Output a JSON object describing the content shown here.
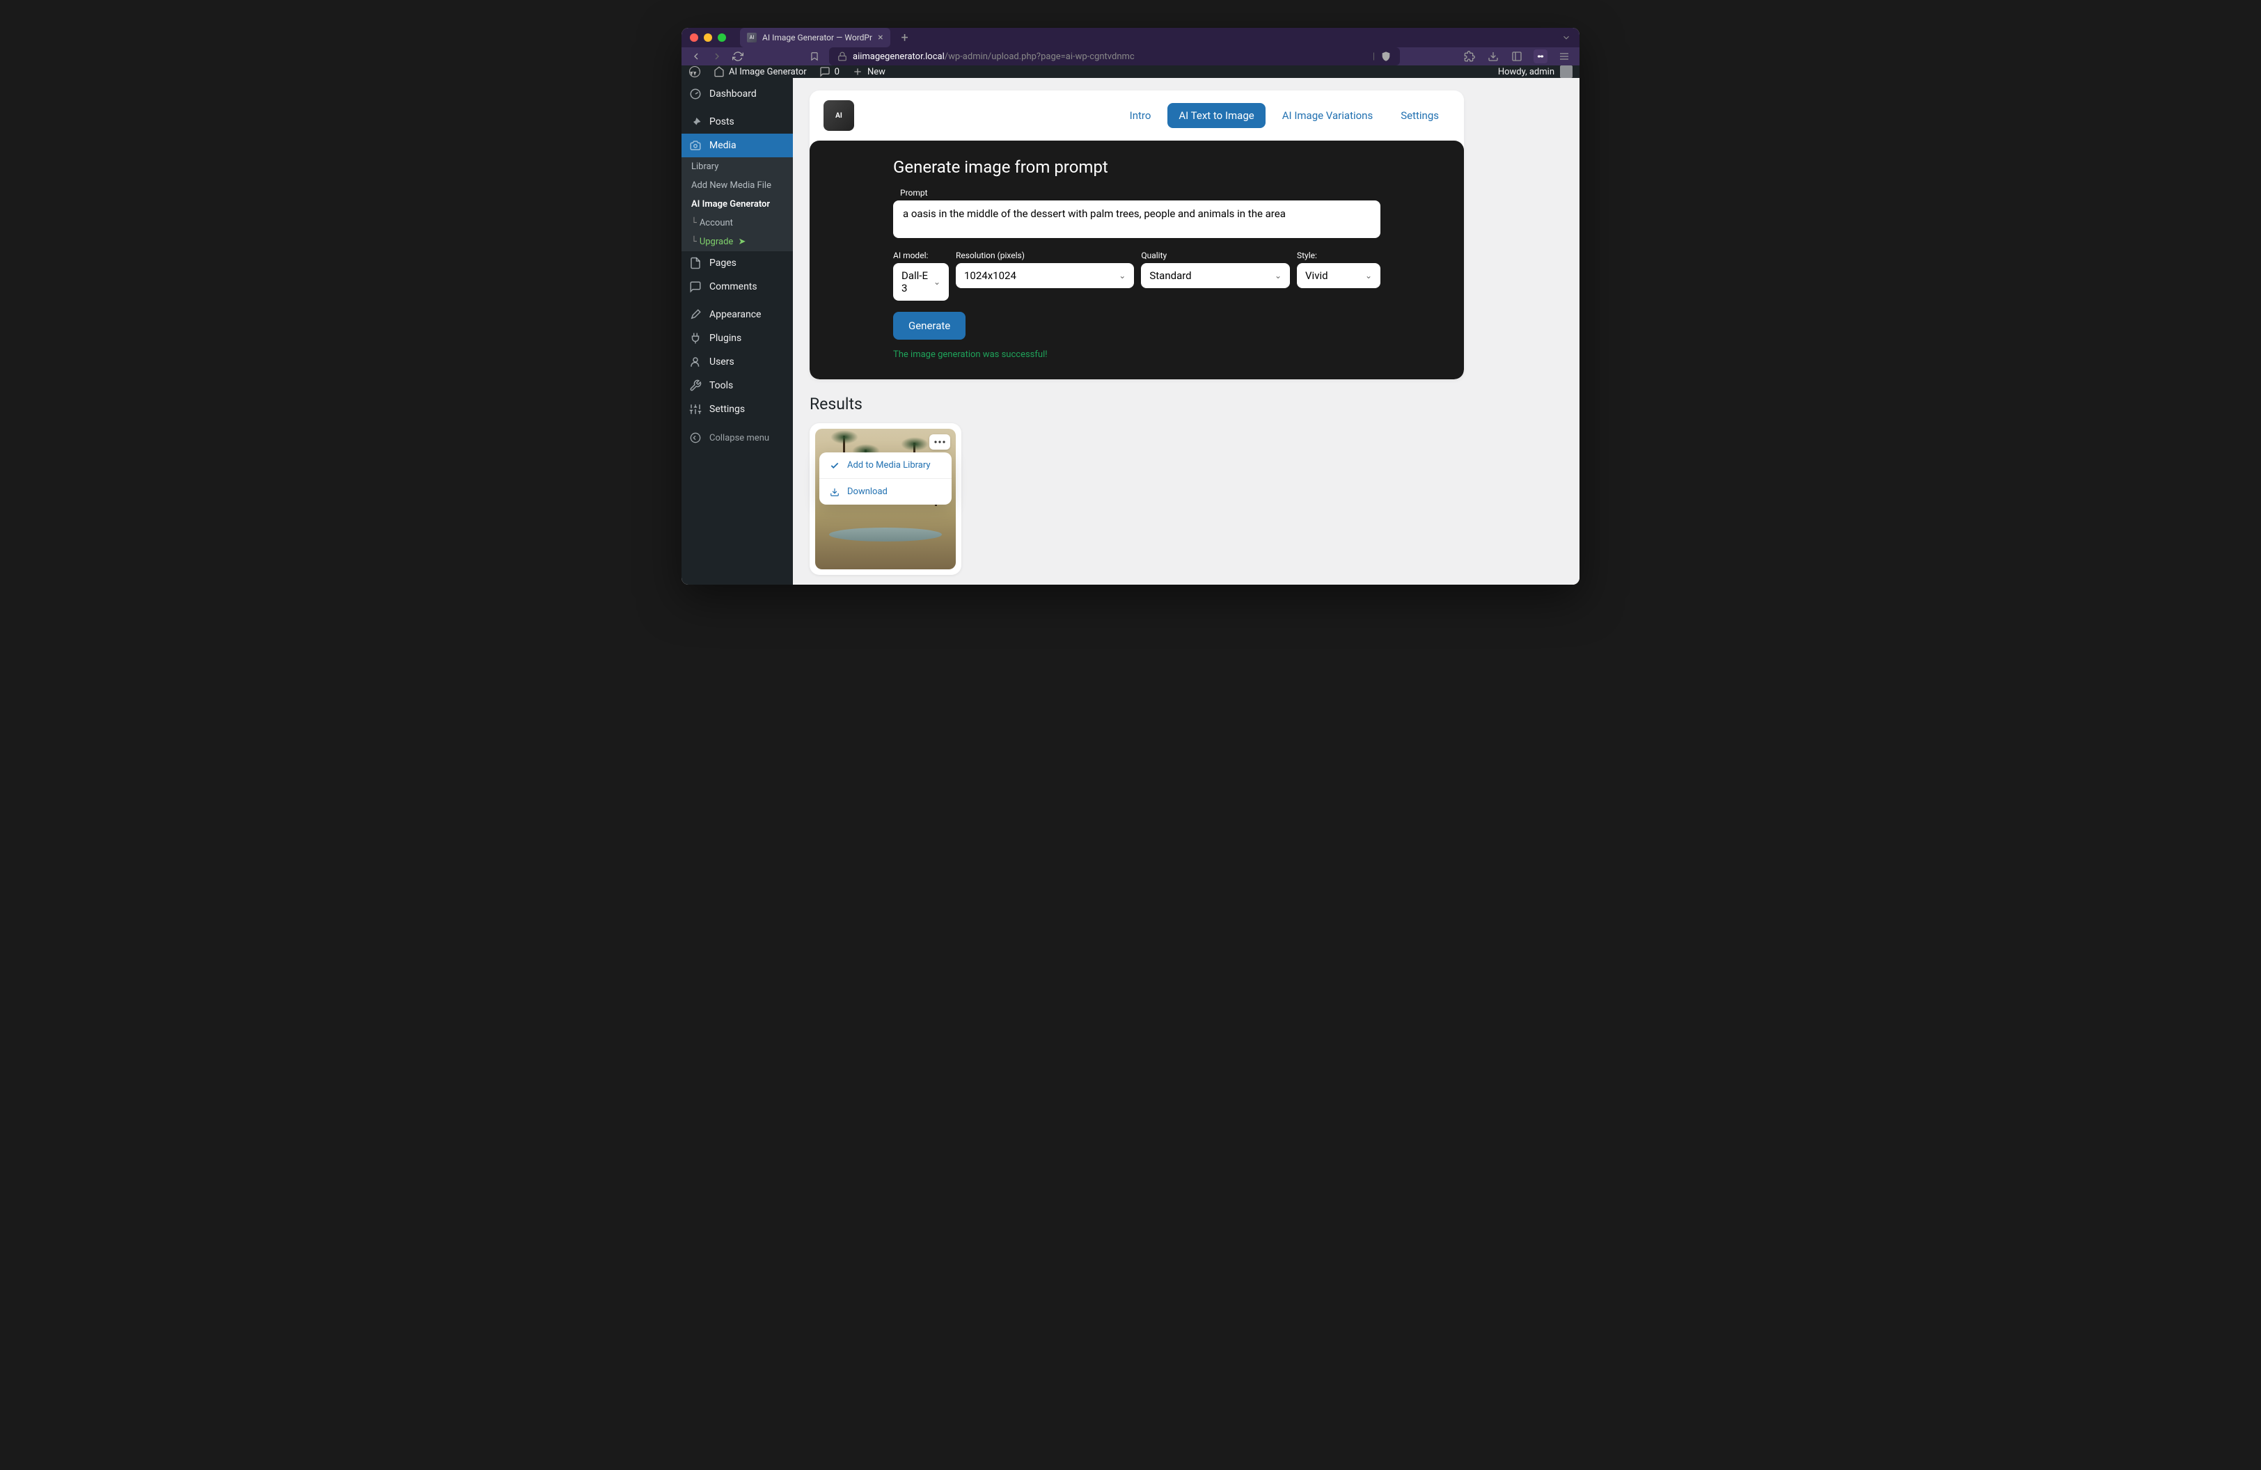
{
  "browser": {
    "tab_title": "AI Image Generator — WordPr",
    "url_host": "aiimagegenerator.local",
    "url_path": "/wp-admin/upload.php?page=ai-wp-cgntvdnmc"
  },
  "wp_bar": {
    "site_name": "AI Image Generator",
    "comments_count": "0",
    "new_label": "New",
    "howdy": "Howdy, admin"
  },
  "sidebar": {
    "dashboard": "Dashboard",
    "posts": "Posts",
    "media": "Media",
    "media_sub": {
      "library": "Library",
      "add_new": "Add New Media File",
      "ai_gen": "AI Image Generator",
      "account": "Account",
      "upgrade": "Upgrade"
    },
    "pages": "Pages",
    "comments": "Comments",
    "appearance": "Appearance",
    "plugins": "Plugins",
    "users": "Users",
    "tools": "Tools",
    "settings": "Settings",
    "collapse": "Collapse menu"
  },
  "header_nav": {
    "intro": "Intro",
    "text_to_image": "AI Text to Image",
    "variations": "AI Image Variations",
    "settings": "Settings"
  },
  "panel": {
    "title": "Generate image from prompt",
    "prompt_label": "Prompt",
    "prompt_value": "a oasis in the middle of the dessert with palm trees, people and animals in the area",
    "model_label": "AI model:",
    "model_value": "Dall-E 3",
    "resolution_label": "Resolution (pixels)",
    "resolution_value": "1024x1024",
    "quality_label": "Quality",
    "quality_value": "Standard",
    "style_label": "Style:",
    "style_value": "Vivid",
    "generate_btn": "Generate",
    "success_msg": "The image generation was successful!"
  },
  "results": {
    "title": "Results",
    "popup": {
      "add_to_library": "Add to Media Library",
      "download": "Download"
    }
  }
}
